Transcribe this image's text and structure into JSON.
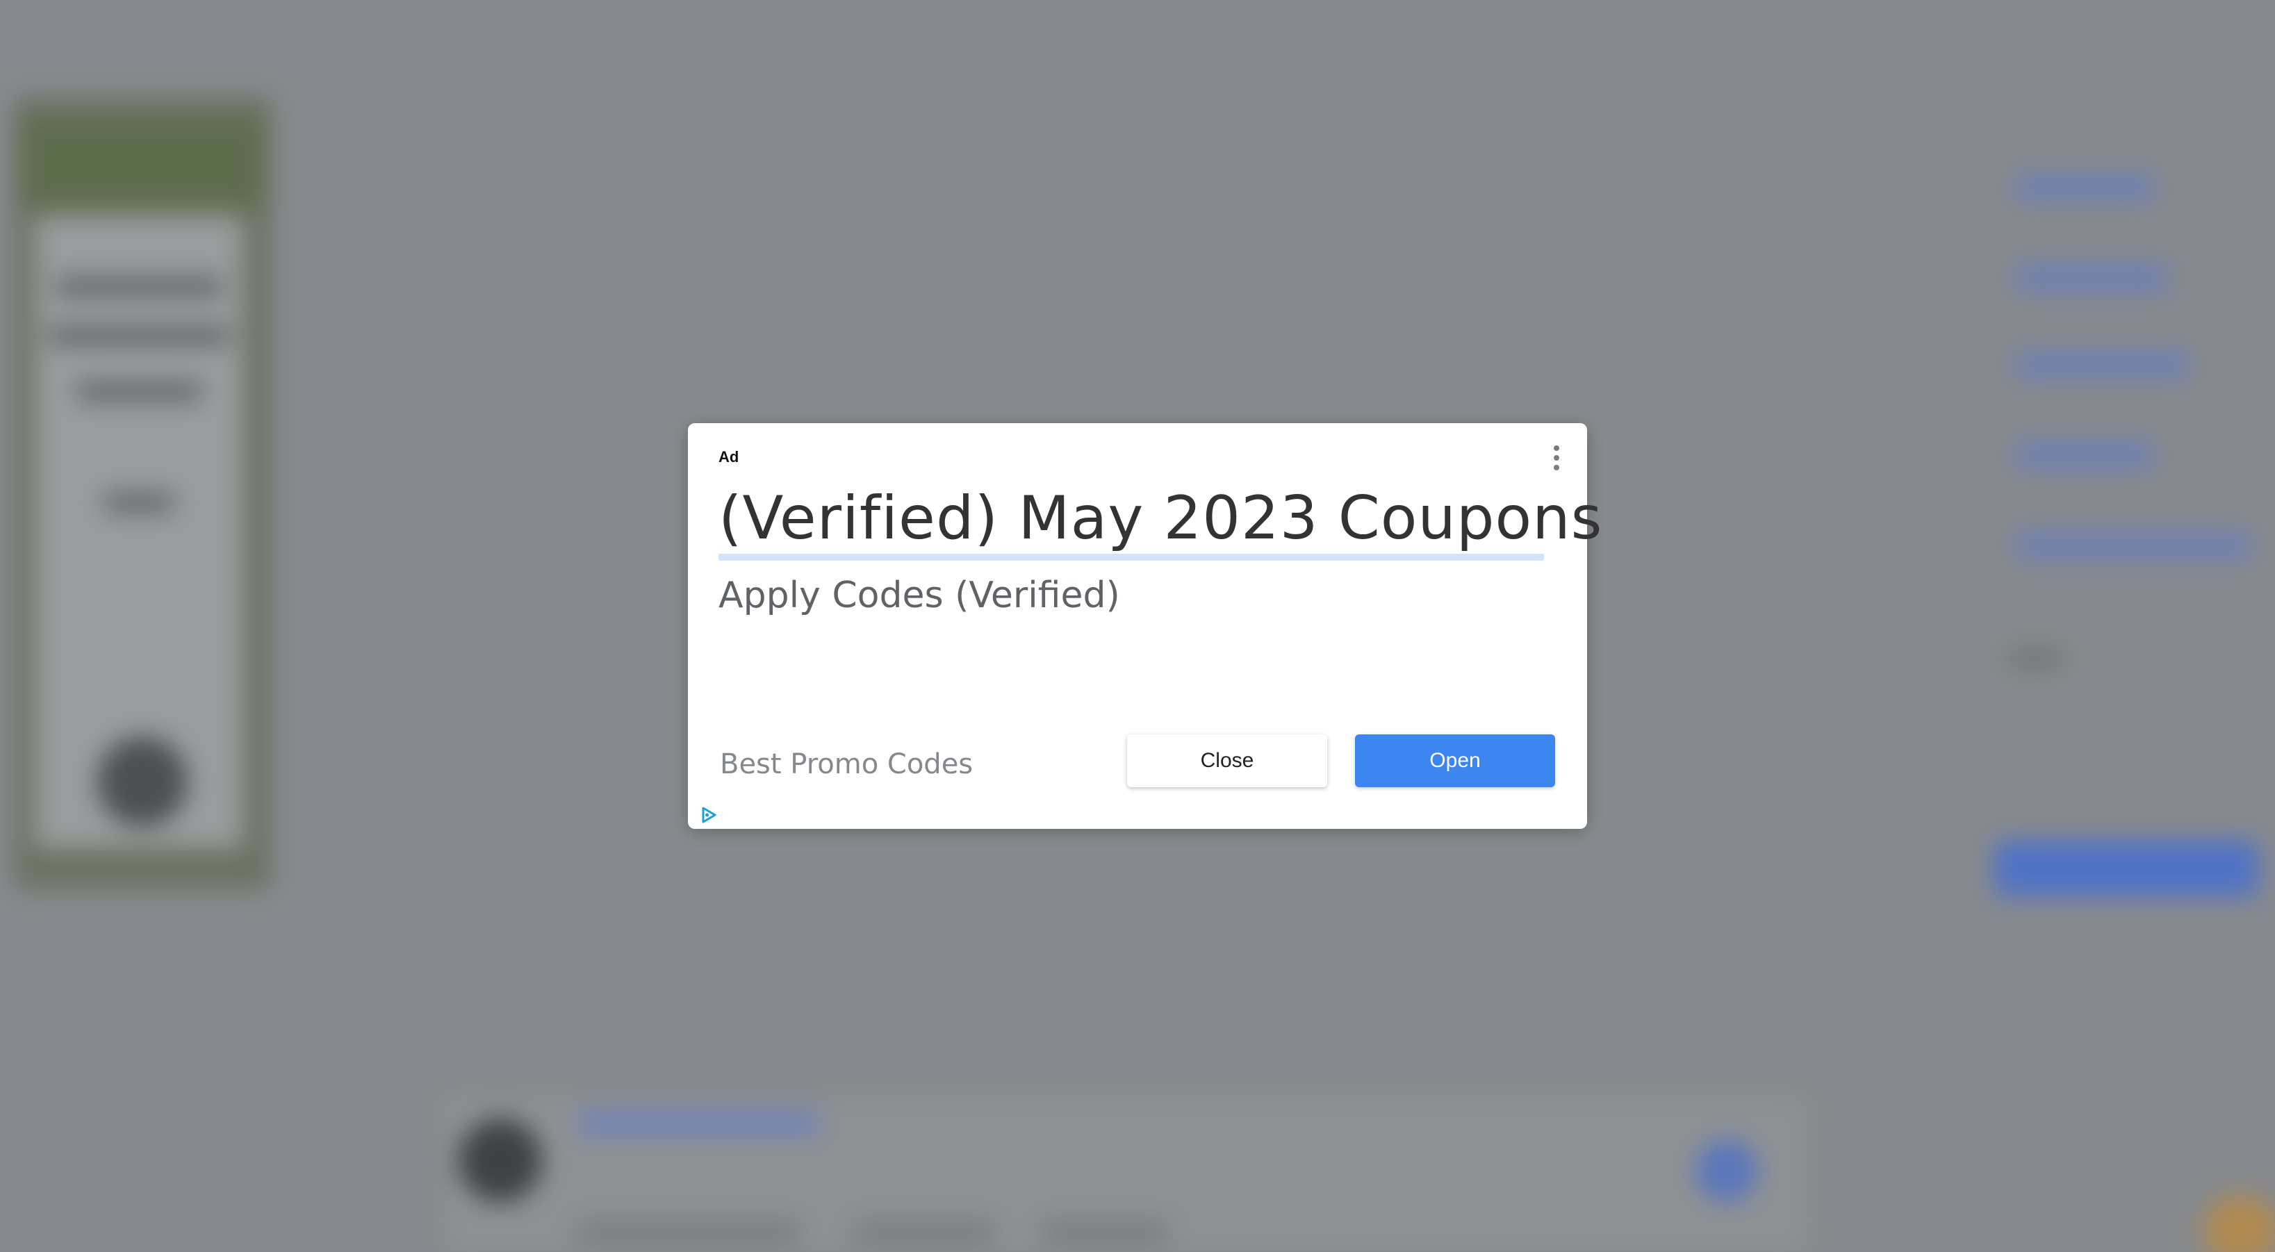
{
  "ad": {
    "label": "Ad",
    "headline": "(Verified) May 2023 Coupons",
    "subtitle": "Apply Codes (Verified)",
    "advertiser": "Best Promo Codes",
    "close_label": "Close",
    "open_label": "Open"
  },
  "icons": {
    "menu": "more-vert-icon",
    "adchoices": "adchoices-icon"
  },
  "colors": {
    "overlay": "#878a8e",
    "open_button": "#3d86f0",
    "headline_underline": "#d3e3fb",
    "adchoices": "#1aa0d8"
  }
}
